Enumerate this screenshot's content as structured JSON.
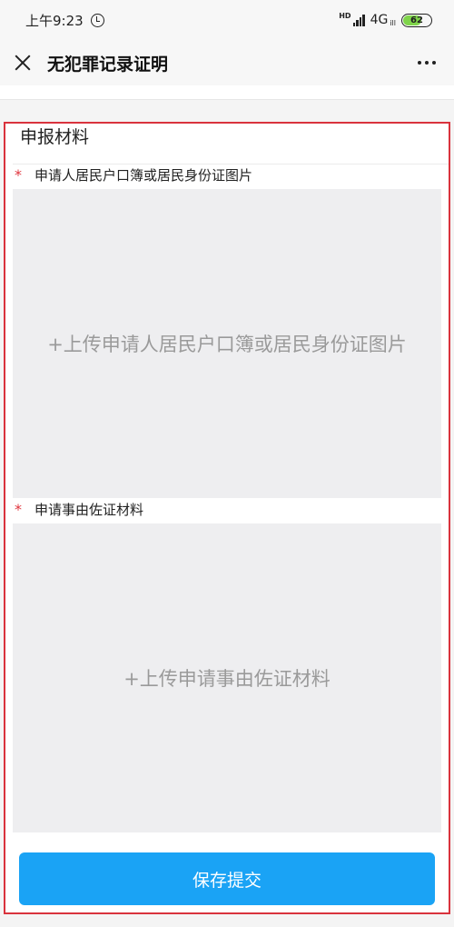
{
  "status_bar": {
    "time": "上午9:23",
    "hd": "HD",
    "network": "4G",
    "network_sub": "ill",
    "battery": "62"
  },
  "nav": {
    "title": "无犯罪记录证明"
  },
  "form": {
    "section_title": "申报材料",
    "fields": [
      {
        "required_mark": "*",
        "label": "申请人居民户口簿或居民身份证图片",
        "upload_text": "+上传申请人居民户口簿或居民身份证图片"
      },
      {
        "required_mark": "*",
        "label": "申请事由佐证材料",
        "upload_text": "+上传申请事由佐证材料"
      }
    ],
    "submit_label": "保存提交"
  },
  "colors": {
    "accent": "#1aa3f5",
    "highlight_border": "#d9333d",
    "required": "#e0353e",
    "battery": "#7fd44a"
  }
}
